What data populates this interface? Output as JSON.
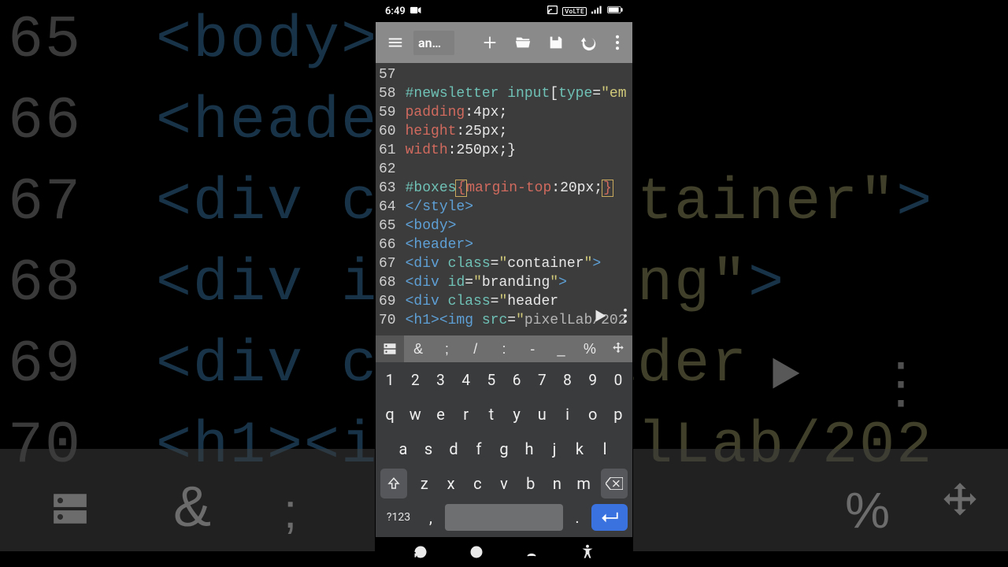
{
  "statusbar": {
    "time": "6:49"
  },
  "toolbar": {
    "tab_label": "an…"
  },
  "code_lines": [
    {
      "n": "57",
      "html": ""
    },
    {
      "n": "58",
      "html": "<span class='c-sel'>#newsletter</span> <span class='c-sel'>input</span><span class='c-punc'>[</span><span class='c-attr'>type</span><span class='c-punc'>=</span><span class='c-str'>\"em</span>"
    },
    {
      "n": "59",
      "html": "<span class='c-prop'>padding</span><span class='c-punc'>:</span><span class='c-val'>4px</span><span class='c-punc'>;</span>"
    },
    {
      "n": "60",
      "html": "<span class='c-prop'>height</span><span class='c-punc'>:</span><span class='c-val'>25px</span><span class='c-punc'>;</span>"
    },
    {
      "n": "61",
      "html": "<span class='c-prop'>width</span><span class='c-punc'>:</span><span class='c-val'>250px</span><span class='c-punc'>;</span><span class='c-punc'>}</span>"
    },
    {
      "n": "62",
      "html": ""
    },
    {
      "n": "63",
      "html": "<span class='c-sel'>#boxes</span><span class='c-brace-hl'>{</span><span class='c-prop'>margin-top</span><span class='c-punc'>:</span><span class='c-val'>20px</span><span class='c-punc'>;</span><span class='c-brace-hl'>}</span>"
    },
    {
      "n": "64",
      "html": "<span class='c-tag'>&lt;/style&gt;</span>"
    },
    {
      "n": "65",
      "html": "<span class='c-tag'>&lt;body&gt;</span>"
    },
    {
      "n": "66",
      "html": "<span class='c-tag'>&lt;header&gt;</span>"
    },
    {
      "n": "67",
      "html": "<span class='c-tag'>&lt;div</span> <span class='c-attr'>class</span><span class='c-punc'>=</span><span class='c-str'>\"</span><span class='c-val'>container</span><span class='c-str'>\"</span><span class='c-tag'>&gt;</span>"
    },
    {
      "n": "68",
      "html": "<span class='c-tag'>&lt;div</span> <span class='c-attr'>id</span><span class='c-punc'>=</span><span class='c-str'>\"</span><span class='c-val'>branding</span><span class='c-str'>\"</span><span class='c-tag'>&gt;</span>"
    },
    {
      "n": "69",
      "html": "<span class='c-tag'>&lt;div</span> <span class='c-attr'>class</span><span class='c-punc'>=</span><span class='c-str'>\"</span><span class='c-val'>header</span>"
    },
    {
      "n": "70",
      "html": "<span class='c-tag'>&lt;h1&gt;&lt;img</span> <span class='c-attr'>src</span><span class='c-punc'>=</span><span class='c-str'>\"</span><span class='c-val' style='opacity:.7'>pixelLab/202</span>"
    }
  ],
  "kb_special": [
    "&",
    ";",
    "/",
    ":",
    "-",
    "_",
    "%"
  ],
  "kb_rows": {
    "nums": [
      "1",
      "2",
      "3",
      "4",
      "5",
      "6",
      "7",
      "8",
      "9",
      "0"
    ],
    "row2": [
      "q",
      "w",
      "e",
      "r",
      "t",
      "y",
      "u",
      "i",
      "o",
      "p"
    ],
    "row3": [
      "a",
      "s",
      "d",
      "f",
      "g",
      "h",
      "j",
      "k",
      "l"
    ],
    "row4": [
      "z",
      "x",
      "c",
      "v",
      "b",
      "n",
      "m"
    ],
    "sym_label": "?123"
  },
  "bg_lines": [
    {
      "n": "65",
      "html": "<span>&lt;body&gt;</span>"
    },
    {
      "n": "66",
      "html": "<span>&lt;header&gt;</span>"
    },
    {
      "n": "67",
      "html": "<span>&lt;div cl</span><span style='opacity:0'>xxxxx</span><span class='t-str'>ntainer\"</span><span>&gt;</span>"
    },
    {
      "n": "68",
      "html": "<span>&lt;div id</span><span style='opacity:0'>xxxxx</span><span class='t-str'>ing\"</span><span>&gt;</span>"
    },
    {
      "n": "69",
      "html": "<span>&lt;div cl</span><span style='opacity:0'>xxxxx</span><span class='t-str'>ader</span>"
    },
    {
      "n": "70",
      "html": "<span>&lt;h1&gt;&lt;img</span><span style='opacity:0'>xx</span><span class='t-str'>ixelLab/202</span>"
    }
  ]
}
